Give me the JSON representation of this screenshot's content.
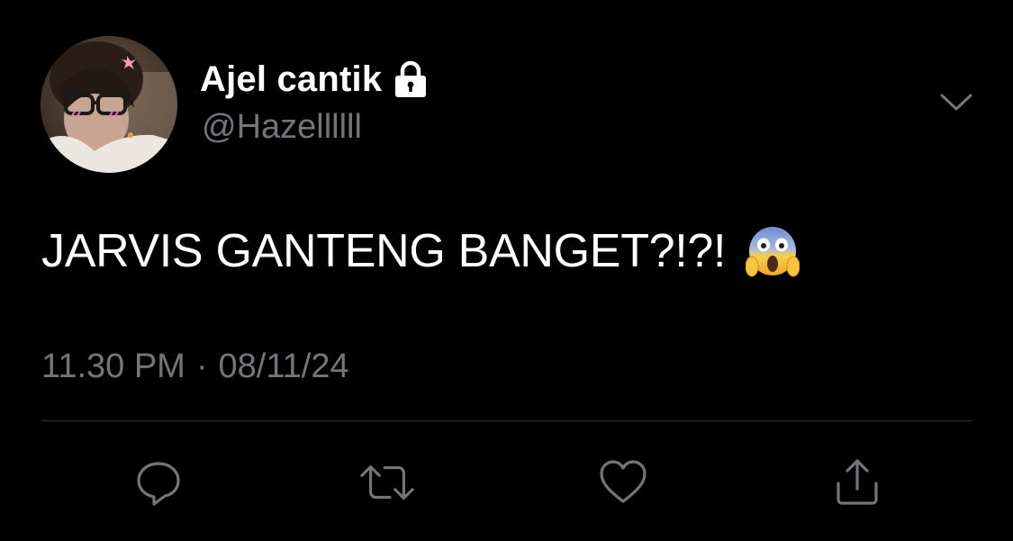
{
  "user": {
    "display_name": "Ajel cantik",
    "handle": "@Hazellllll",
    "protected_icon": "lock-icon",
    "avatar_icon": "profile-photo"
  },
  "tweet": {
    "text": "JARVIS GANTENG BANGET?!?!",
    "emoji": "😱",
    "time": "11.30 PM",
    "separator": "·",
    "date": "08/11/24"
  },
  "menu": {
    "icon": "chevron-down-icon"
  },
  "actions": [
    {
      "name": "reply",
      "icon": "reply-icon"
    },
    {
      "name": "retweet",
      "icon": "retweet-icon"
    },
    {
      "name": "like",
      "icon": "heart-icon"
    },
    {
      "name": "share",
      "icon": "share-icon"
    }
  ],
  "colors": {
    "background": "#000000",
    "primary_text": "#ffffff",
    "secondary_text": "#71767b",
    "divider": "#2f3336"
  }
}
